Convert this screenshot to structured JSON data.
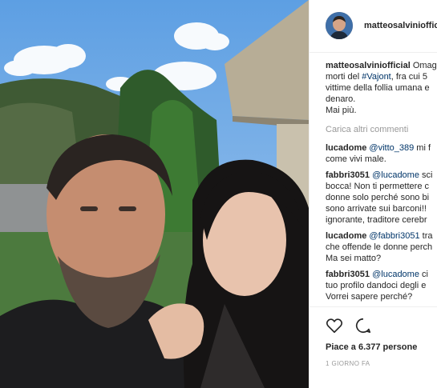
{
  "post": {
    "username": "matteosalviniofficial",
    "likes": "Piace a 6.377 persone",
    "timestamp": "1 GIORNO FA"
  },
  "caption": {
    "user": "matteosalviniofficial",
    "line1": "Omag",
    "line2_pre": "morti del ",
    "line2_tag": "#Vajont",
    "line2_post": ", fra cui 5",
    "line3": "vittime della follia umana e",
    "line4": "denaro.",
    "line5": "Mai più."
  },
  "load_more": "Carica altri commenti",
  "comments": [
    {
      "user": "lucadome",
      "tag": "@vitto_389",
      "text": " mi f",
      "lines": [
        "come vivi male."
      ]
    },
    {
      "user": "fabbri3051",
      "tag": "@lucadome",
      "text": " sci",
      "lines": [
        "bocca! Non ti permettere c",
        "donne solo perché sono bi",
        "sono arrivate sui barconi!!",
        "ignorante, traditore cerebr"
      ]
    },
    {
      "user": "lucadome",
      "tag": "@fabbri3051",
      "text": " tra",
      "lines": [
        "che offende le donne perch",
        "Ma sei matto?"
      ]
    },
    {
      "user": "fabbri3051",
      "tag": "@lucadome",
      "text": " ci",
      "lines": [
        "tuo profilo dandoci degli e",
        "Vorrei sapere perché?"
      ]
    }
  ],
  "icons": {
    "like": "heart-icon",
    "comment": "comment-icon"
  }
}
